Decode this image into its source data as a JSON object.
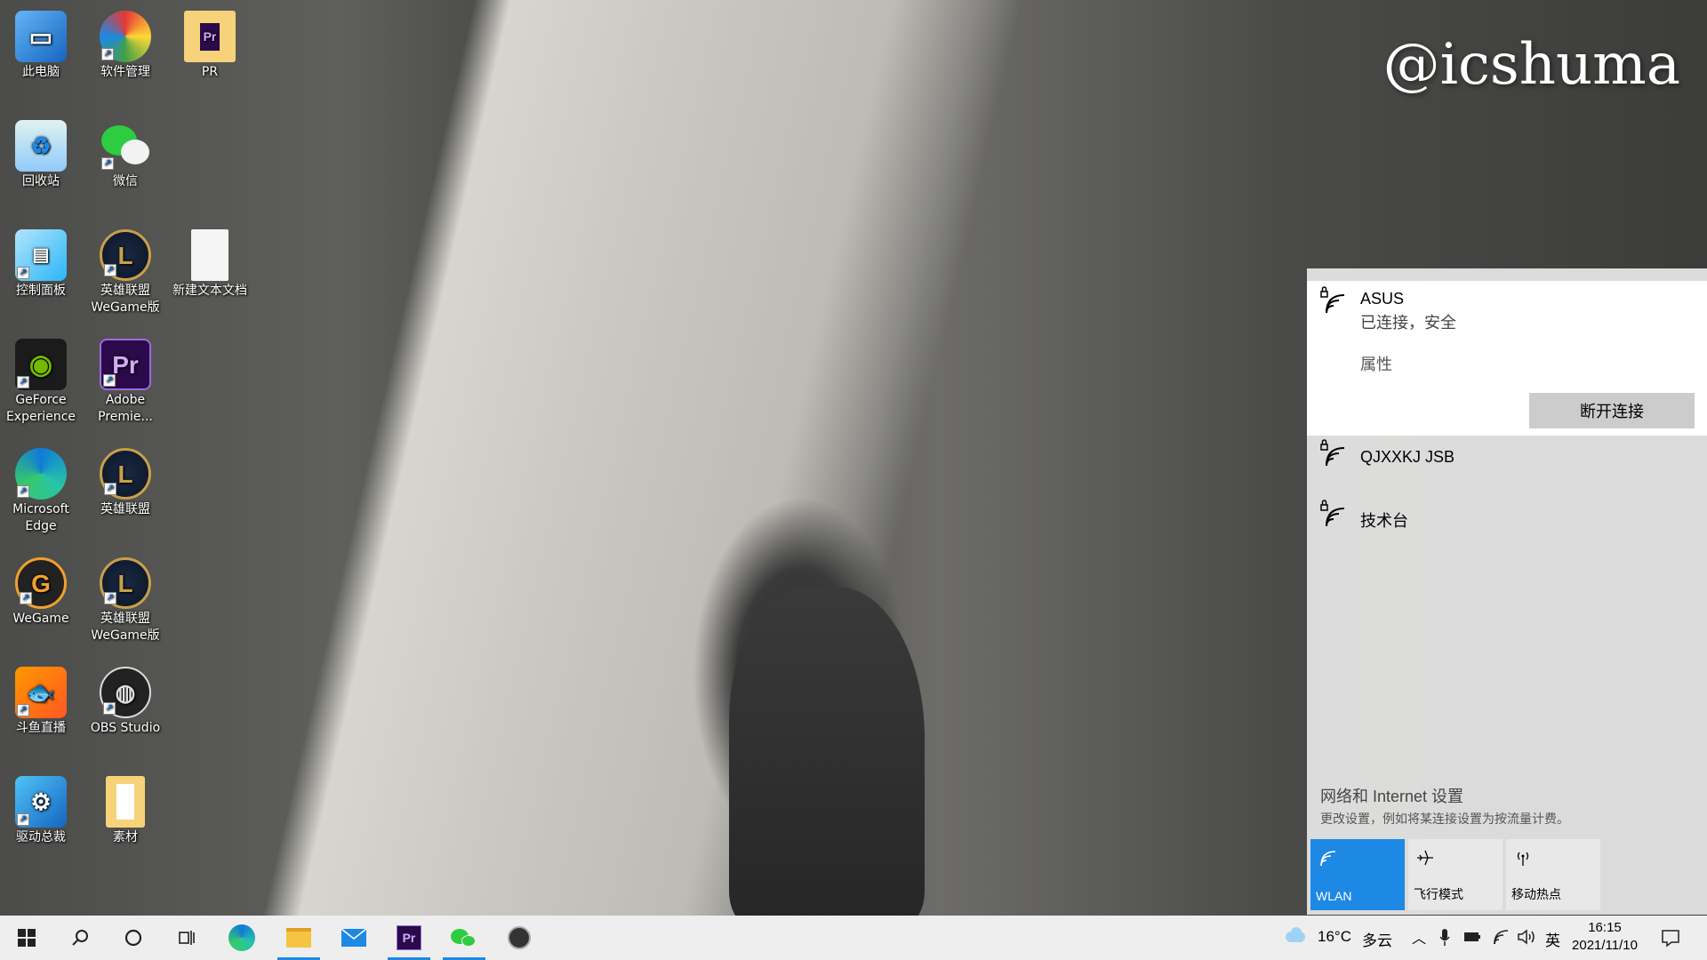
{
  "watermark": "@icshuma",
  "desktop_icons": [
    {
      "label": "此电脑",
      "icon": "computer-icon"
    },
    {
      "label": "软件管理",
      "icon": "software-manager-icon"
    },
    {
      "label": "PR",
      "icon": "folder-icon"
    },
    {
      "label": "回收站",
      "icon": "recycle-bin-icon"
    },
    {
      "label": "微信",
      "icon": "wechat-icon"
    },
    {
      "label": "控制面板",
      "icon": "control-panel-icon"
    },
    {
      "label": "英雄联盟 WeGame版",
      "icon": "league-icon"
    },
    {
      "label": "新建文本文档",
      "icon": "text-file-icon"
    },
    {
      "label": "GeForce Experience",
      "icon": "nvidia-icon"
    },
    {
      "label": "Adobe Premie...",
      "icon": "premiere-icon"
    },
    {
      "label": "Microsoft Edge",
      "icon": "edge-icon"
    },
    {
      "label": "英雄联盟",
      "icon": "league-icon"
    },
    {
      "label": "WeGame",
      "icon": "wegame-icon"
    },
    {
      "label": "英雄联盟 WeGame版",
      "icon": "league-icon"
    },
    {
      "label": "斗鱼直播",
      "icon": "douyu-icon"
    },
    {
      "label": "OBS Studio",
      "icon": "obs-icon"
    },
    {
      "label": "驱动总裁",
      "icon": "driver-icon"
    },
    {
      "label": "素材",
      "icon": "folder-icon"
    }
  ],
  "flyout": {
    "selected_network": {
      "name": "ASUS",
      "status": "已连接，安全",
      "properties_link": "属性",
      "disconnect_label": "断开连接"
    },
    "networks": [
      {
        "name": "QJXXKJ JSB"
      },
      {
        "name": "技术台"
      }
    ],
    "settings_title": "网络和 Internet 设置",
    "settings_desc": "更改设置，例如将某连接设置为按流量计费。",
    "tiles": [
      {
        "label": "WLAN",
        "icon": "wifi-icon",
        "active": true
      },
      {
        "label": "飞行模式",
        "icon": "airplane-icon",
        "active": false
      },
      {
        "label": "移动热点",
        "icon": "hotspot-icon",
        "active": false
      }
    ]
  },
  "taskbar": {
    "weather_temp": "16°C",
    "weather_desc": "多云",
    "ime": "英",
    "time": "16:15",
    "date": "2021/11/10"
  },
  "colors": {
    "accent": "#1e88e5",
    "flyout_bg": "#e2e2e2",
    "taskbar_bg": "#eeeeee"
  }
}
